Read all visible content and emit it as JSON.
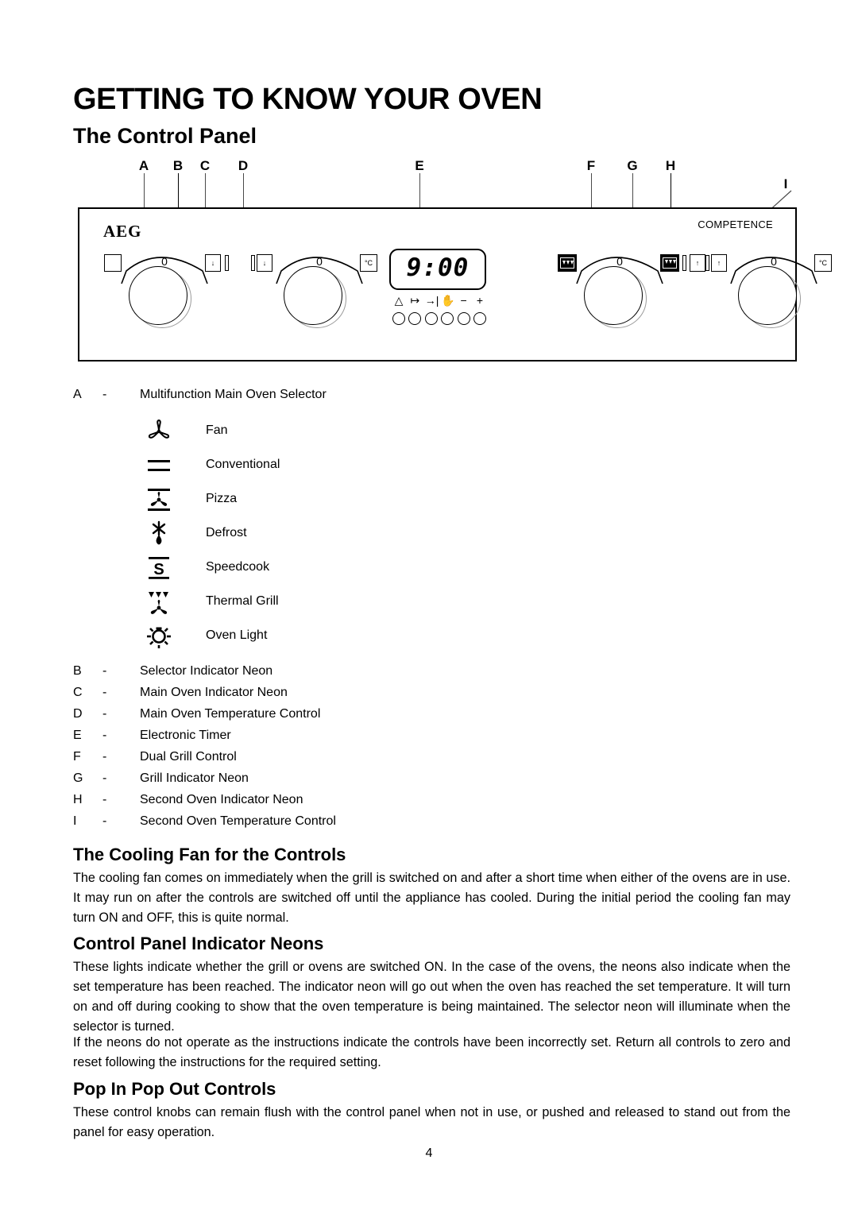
{
  "document": {
    "title": "GETTING TO KNOW YOUR OVEN",
    "subtitle": "The Control Panel",
    "page_number": "4"
  },
  "diagram": {
    "callouts": [
      {
        "letter": "A"
      },
      {
        "letter": "B"
      },
      {
        "letter": "C"
      },
      {
        "letter": "D"
      },
      {
        "letter": "E"
      },
      {
        "letter": "F"
      },
      {
        "letter": "G"
      },
      {
        "letter": "H"
      },
      {
        "letter": "I"
      }
    ],
    "brand": "AEG",
    "range_name": "COMPETENCE",
    "knob_zero": "0",
    "celsius_label": "°C",
    "timer": {
      "display": "9:00",
      "digits_left": "9",
      "digits_right": "00",
      "symbols": [
        "bell-icon",
        "arrow-to-bar-icon",
        "arrow-into-bar-icon",
        "hand-icon",
        "minus-icon",
        "plus-icon"
      ],
      "symbol_glyphs": [
        "△",
        "↦",
        "→|",
        "✋",
        "−",
        "+"
      ],
      "button_count": 6
    }
  },
  "legend": {
    "a_row": {
      "letter": "A",
      "dash": "-",
      "text": "Multifunction Main Oven Selector"
    },
    "functions": [
      {
        "icon": "fan-icon",
        "label": "Fan"
      },
      {
        "icon": "conventional-icon",
        "label": "Conventional"
      },
      {
        "icon": "pizza-icon",
        "label": "Pizza"
      },
      {
        "icon": "defrost-icon",
        "label": "Defrost"
      },
      {
        "icon": "speedcook-icon",
        "label": "Speedcook"
      },
      {
        "icon": "thermal-grill-icon",
        "label": "Thermal Grill"
      },
      {
        "icon": "oven-light-icon",
        "label": "Oven Light"
      }
    ],
    "items": [
      {
        "letter": "B",
        "dash": "-",
        "text": "Selector Indicator Neon"
      },
      {
        "letter": "C",
        "dash": "-",
        "text": "Main Oven Indicator Neon"
      },
      {
        "letter": "D",
        "dash": "-",
        "text": "Main Oven Temperature Control"
      },
      {
        "letter": "E",
        "dash": "-",
        "text": "Electronic Timer"
      },
      {
        "letter": "F",
        "dash": "-",
        "text": "Dual Grill Control"
      },
      {
        "letter": "G",
        "dash": "-",
        "text": "Grill Indicator Neon"
      },
      {
        "letter": "H",
        "dash": "-",
        "text": "Second Oven Indicator Neon"
      },
      {
        "letter": "I",
        "dash": "-",
        "text": "Second Oven Temperature Control"
      }
    ]
  },
  "sections": [
    {
      "heading": "The Cooling Fan for the Controls",
      "body": "The cooling fan comes on immediately when the grill is switched on and after a short time when either of  the ovens are in use. It may run on after the controls are switched  off  until the appliance has cooled. During the initial period the cooling fan may turn ON and OFF, this is quite normal."
    },
    {
      "heading": "Control Panel Indicator Neons",
      "body": "These lights indicate whether the grill or ovens are switched ON.  In the case of the ovens, the neons also indicate when the set temperature has been reached.  The indicator neon will go out when the oven has reached the set temperature.  It will turn on and off during cooking to show that the oven temperature is being maintained. The selector neon will illuminate when the selector is turned.",
      "body2": "If the neons do not operate as the instructions indicate the controls have been incorrectly set. Return all controls to zero and reset following the instructions for the required setting."
    },
    {
      "heading": "Pop In Pop Out Controls",
      "body": "These control knobs can remain flush with the control panel when not in use, or pushed and released to stand out from the panel for easy operation."
    }
  ]
}
